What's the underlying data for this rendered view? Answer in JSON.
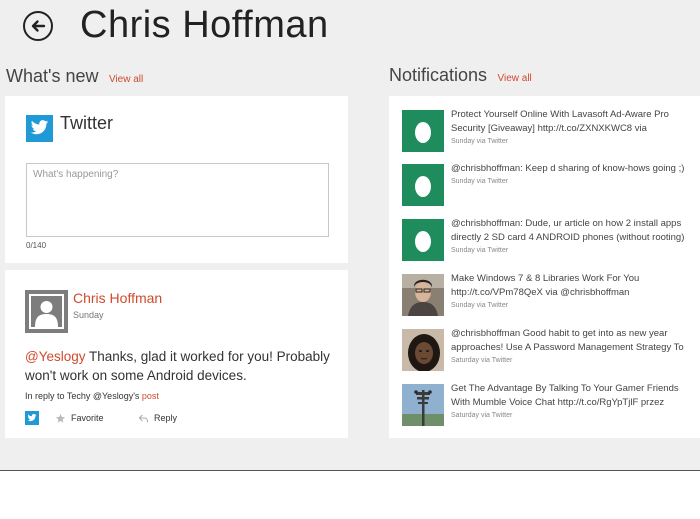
{
  "header": {
    "title": "Chris Hoffman"
  },
  "whats_new": {
    "heading": "What's new",
    "view_all": "View all",
    "twitter": {
      "name": "Twitter",
      "placeholder": "What's happening?",
      "char_count": "0/140"
    },
    "message": {
      "author": "Chris Hoffman",
      "time": "Sunday",
      "mention": "@Yeslogy",
      "body": " Thanks, glad it worked for you! Probably won't work on some Android devices.",
      "reply_prefix": "In reply to Techy @Yeslogy's ",
      "reply_link": "post",
      "favorite_label": "Favorite",
      "reply_label": "Reply"
    }
  },
  "notifications": {
    "heading": "Notifications",
    "view_all": "View all",
    "items": [
      {
        "avatar": "egg",
        "line1": "Protect Yourself Online With Lavasoft Ad-Aware Pro",
        "line2": "Security [Giveaway] http://t.co/ZXNXKWC8 via",
        "meta": "Sunday via Twitter"
      },
      {
        "avatar": "egg",
        "line1": "@chrisbhoffman: Keep d sharing of know-hows going ;)",
        "line2": "",
        "meta": "Sunday via Twitter"
      },
      {
        "avatar": "egg",
        "line1": "@chrisbhoffman: Dude, ur article on how 2 install apps",
        "line2": "directly 2 SD card 4 ANDROID phones (without rooting)",
        "meta": "Sunday via Twitter"
      },
      {
        "avatar": "photo-man",
        "line1": "Make Windows 7 & 8 Libraries Work For You",
        "line2": "http://t.co/VPm78QeX via @chrisbhoffman",
        "meta": "Sunday via Twitter"
      },
      {
        "avatar": "photo-woman",
        "line1": "@chrisbhoffman Good habit to get into as new year",
        "line2": "approaches! Use A Password Management Strategy To",
        "meta": "Saturday via Twitter"
      },
      {
        "avatar": "photo-tower",
        "line1": "Get The Advantage By Talking To Your Gamer Friends",
        "line2": "With Mumble Voice Chat http://t.co/RgYpTjlF przez",
        "meta": "Saturday via Twitter"
      }
    ]
  },
  "colors": {
    "accent": "#d04a2e",
    "twitter_blue": "#1f9ad6",
    "egg_green": "#1f8c5e",
    "background": "#efefef"
  }
}
